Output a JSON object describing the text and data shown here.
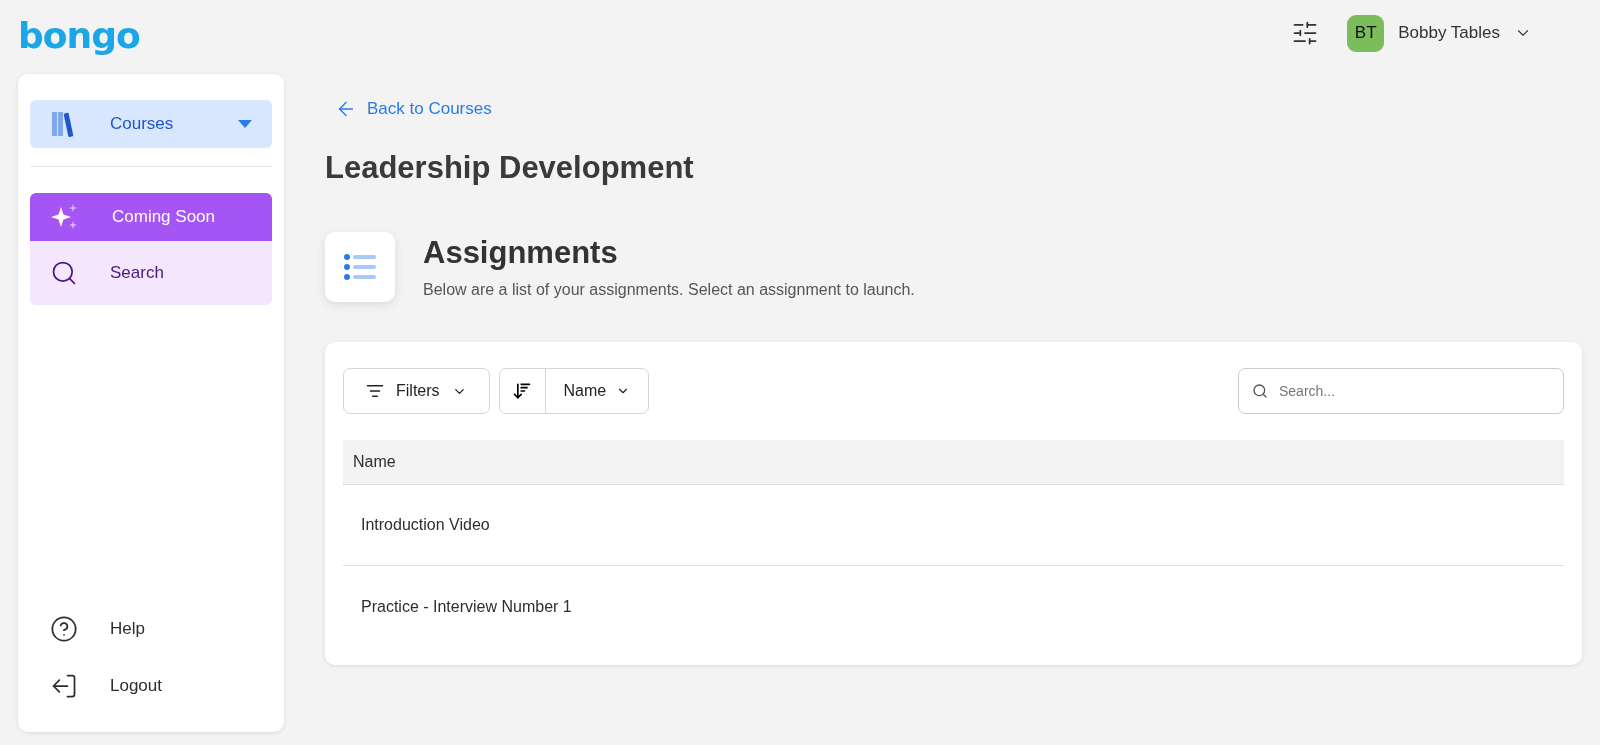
{
  "logo": "bongo",
  "header": {
    "user": {
      "initials": "BT",
      "name": "Bobby Tables",
      "color": "#7cbd5b"
    }
  },
  "sidebar": {
    "dropdown": {
      "label": "Courses"
    },
    "items": [
      {
        "label": "Coming Soon",
        "kind": "banner"
      },
      {
        "label": "Search",
        "kind": "search"
      }
    ],
    "footer": [
      {
        "label": "Help",
        "kind": "help"
      },
      {
        "label": "Logout",
        "kind": "logout"
      }
    ]
  },
  "back_link": "Back to Courses",
  "page_title": "Leadership Development",
  "section": {
    "title": "Assignments",
    "subtitle": "Below are a list of your assignments. Select an assignment to launch."
  },
  "toolbar": {
    "filters": "Filters",
    "sort": "Name",
    "search": {
      "placeholder": "Search..."
    }
  },
  "table": {
    "columns": [
      "Name"
    ],
    "rows": [
      [
        "Introduction Video"
      ],
      [
        "Practice - Interview Number 1"
      ]
    ]
  }
}
